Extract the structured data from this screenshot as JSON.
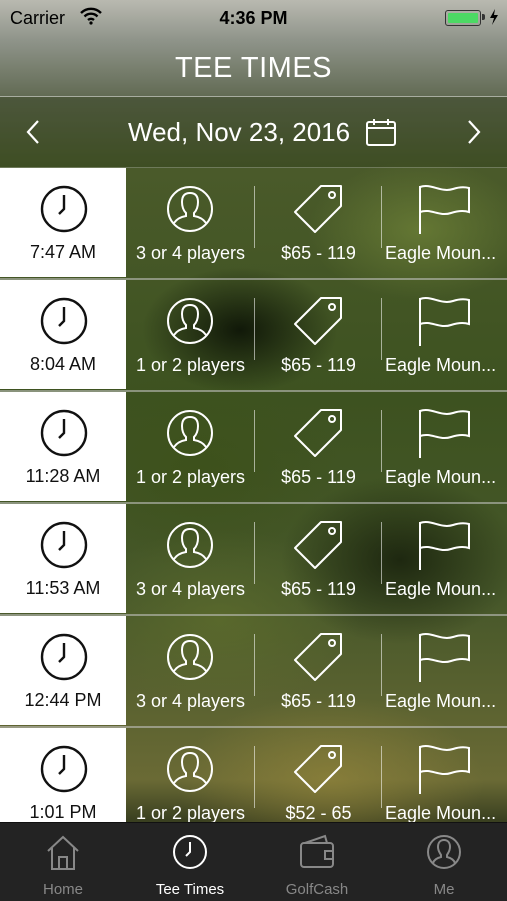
{
  "status_bar": {
    "carrier": "Carrier",
    "time": "4:36 PM",
    "battery_color": "#4cd964"
  },
  "header": {
    "title": "TEE TIMES"
  },
  "date_bar": {
    "date": "Wed, Nov 23, 2016",
    "prev_icon": "chevron-left-icon",
    "next_icon": "chevron-right-icon",
    "calendar_icon": "calendar-icon"
  },
  "tee_times": [
    {
      "time": "7:47 AM",
      "players": "3 or 4 players",
      "price": "$65 - 119",
      "course": "Eagle Moun..."
    },
    {
      "time": "8:04 AM",
      "players": "1 or 2 players",
      "price": "$65 - 119",
      "course": "Eagle Moun..."
    },
    {
      "time": "11:28 AM",
      "players": "1 or 2 players",
      "price": "$65 - 119",
      "course": "Eagle Moun..."
    },
    {
      "time": "11:53 AM",
      "players": "3 or 4 players",
      "price": "$65 - 119",
      "course": "Eagle Moun..."
    },
    {
      "time": "12:44 PM",
      "players": "3 or 4 players",
      "price": "$65 - 119",
      "course": "Eagle Moun..."
    },
    {
      "time": "1:01 PM",
      "players": "1 or 2 players",
      "price": "$52 - 65",
      "course": "Eagle Moun..."
    }
  ],
  "tab_bar": {
    "tabs": [
      {
        "label": "Home",
        "icon": "home-icon",
        "active": false
      },
      {
        "label": "Tee Times",
        "icon": "clock-icon",
        "active": true
      },
      {
        "label": "GolfCash",
        "icon": "wallet-icon",
        "active": false
      },
      {
        "label": "Me",
        "icon": "user-icon",
        "active": false
      }
    ]
  }
}
